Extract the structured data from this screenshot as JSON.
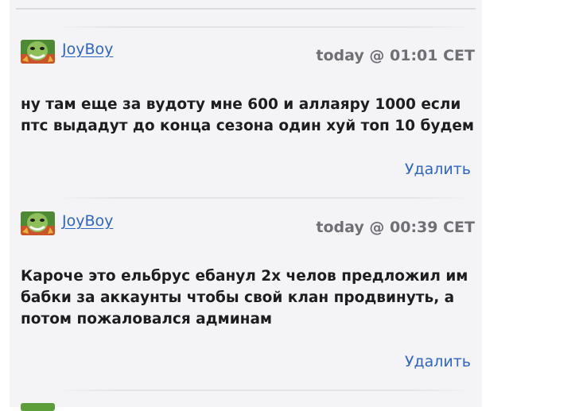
{
  "comments": [
    {
      "author": "JoyBoy",
      "timestamp": "today @ 01:01 CET",
      "text": "ну там еще за вудоту мне 600 и аллаяру 1000 если птс выдадут до конца сезона один хуй топ 10 будем",
      "delete_label": "Удалить"
    },
    {
      "author": "JoyBoy",
      "timestamp": "today @ 00:39 CET",
      "text": "Кароче это ельбрус ебанул 2х челов предложил им бабки за аккаунты чтобы свой клан продвинуть, а потом пожаловался админам",
      "delete_label": "Удалить"
    }
  ]
}
